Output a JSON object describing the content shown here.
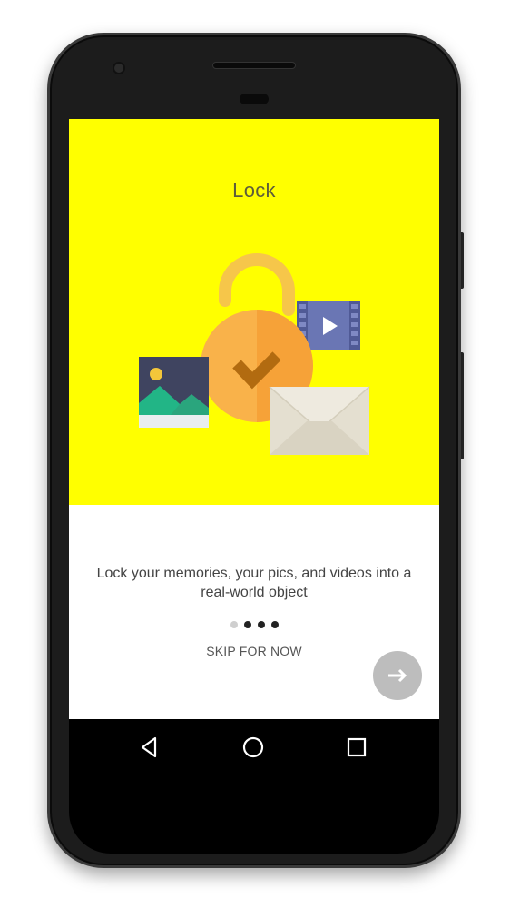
{
  "screen": {
    "title": "Lock",
    "description": "Lock your memories, your pics, and videos into a real-world object",
    "skip_label": "SKIP FOR NOW",
    "page_indicator": {
      "total": 4,
      "active_index": 0
    },
    "next_button_icon": "arrow-right-icon",
    "hero_color": "#ffff00"
  },
  "navbar": {
    "icons": [
      "back-triangle-icon",
      "home-circle-icon",
      "recent-apps-square-icon"
    ]
  }
}
